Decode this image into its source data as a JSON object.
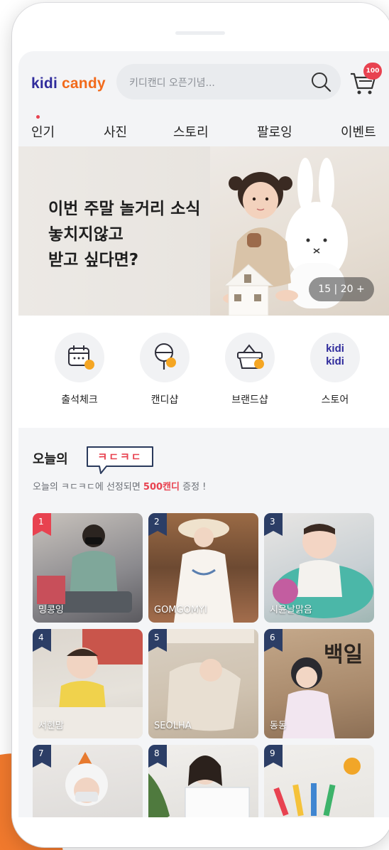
{
  "header": {
    "logo_kidi": "kidi",
    "logo_candy": "candy",
    "search_placeholder": "키디캔디 오픈기념...",
    "cart_badge": "100"
  },
  "tabs": [
    "인기",
    "사진",
    "스토리",
    "팔로잉",
    "이벤트"
  ],
  "banner": {
    "line1": "이번 주말 놀거리 소식",
    "line2": "놓치지않고",
    "line3": "받고 싶다면?",
    "counter": "15 | 20 +"
  },
  "shortcuts": [
    {
      "label": "출석체크",
      "icon": "calendar-check-icon"
    },
    {
      "label": "캔디샵",
      "icon": "lollipop-icon"
    },
    {
      "label": "브랜드샵",
      "icon": "shopping-basket-icon"
    },
    {
      "label": "스토어",
      "icon": "kidi-store-logo-icon",
      "logo_text": "kidi"
    }
  ],
  "today": {
    "title": "오늘의",
    "badge": "ㅋㄷㅋㄷ",
    "sub_before": "오늘의 ㅋㄷㅋㄷ에 선정되면 ",
    "sub_highlight": "500캔디",
    "sub_after": " 증정 !"
  },
  "cards": [
    {
      "num": "1",
      "name": "밍콩잉"
    },
    {
      "num": "2",
      "name": "GOMGOMYI"
    },
    {
      "num": "3",
      "name": "시윤날맑음"
    },
    {
      "num": "4",
      "name": "서현맘"
    },
    {
      "num": "5",
      "name": "SEOLHA"
    },
    {
      "num": "6",
      "name": "동동"
    },
    {
      "num": "7",
      "name": ""
    },
    {
      "num": "8",
      "name": ""
    },
    {
      "num": "9",
      "name": ""
    }
  ],
  "colors": {
    "brand_navy": "#2f2b9c",
    "brand_orange": "#f26a1b",
    "accent_red": "#e84250",
    "rank_flag": "#2c3e66"
  }
}
